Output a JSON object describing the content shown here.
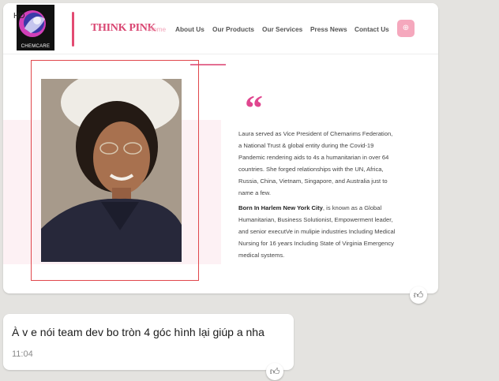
{
  "image_message": {
    "quality_badge": "HD",
    "site": {
      "logo_text": "CHEMCARE",
      "brand": "THINK PINK",
      "nav": [
        {
          "label": "Home",
          "active": true
        },
        {
          "label": "About Us",
          "active": false
        },
        {
          "label": "Our Products",
          "active": false
        },
        {
          "label": "Our Services",
          "active": false
        },
        {
          "label": "Press News",
          "active": false
        },
        {
          "label": "Contact Us",
          "active": false
        }
      ],
      "nav_button_icon": "plus-circle-icon",
      "quote_mark": "“",
      "bio_paragraph_1": "Laura served as Vice President of Chemarims Federation, a National Trust & global entity during the Covid-19 Pandemic rendering aids to 4s a humanitarian in over 64 countries. She forged relationships with the UN, Africa, Russia, China, Vietnam, Singapore, and Australia just to name a few.",
      "bio_paragraph_2_bold": "Born In Harlem New York City",
      "bio_paragraph_2_rest": ", is known as a Global Humanitarian, Business Solutionist, Empowerment leader, and senior executVe in mulipie industries Including Medical Nursing for 16 years Including State of Virginia Emergency medical systems.",
      "accent_color": "#e0468f",
      "frame_color": "#e0474c"
    },
    "like_icon": "thumbs-up-icon"
  },
  "text_message": {
    "text": "À v e nói team dev bo tròn 4 góc hình lại giúp a nha",
    "time": "11:04",
    "like_icon": "thumbs-up-icon"
  }
}
